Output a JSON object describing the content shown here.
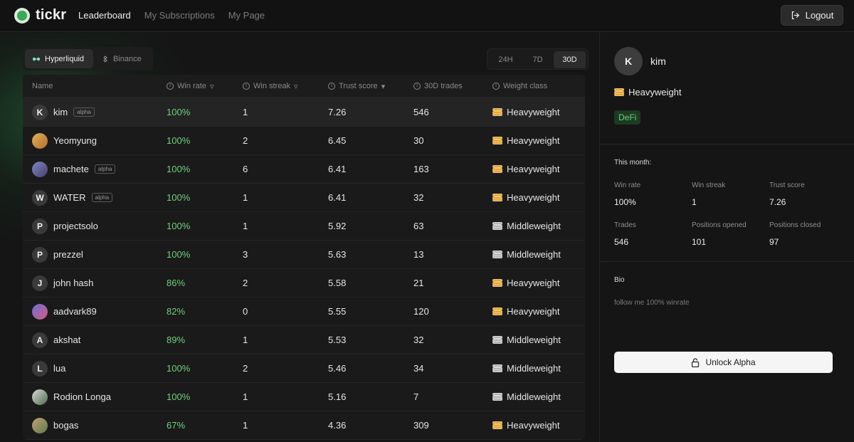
{
  "app": {
    "name": "tickr"
  },
  "nav": {
    "items": [
      {
        "label": "Leaderboard",
        "active": true
      },
      {
        "label": "My Subscriptions",
        "active": false
      },
      {
        "label": "My Page",
        "active": false
      }
    ],
    "logout_label": "Logout"
  },
  "exchanges": [
    {
      "label": "Hyperliquid",
      "icon": "hyperliquid-icon",
      "active": true
    },
    {
      "label": "Binance",
      "icon": "binance-icon",
      "active": false
    }
  ],
  "periods": [
    {
      "label": "24H",
      "active": false
    },
    {
      "label": "7D",
      "active": false
    },
    {
      "label": "30D",
      "active": true
    }
  ],
  "table": {
    "headers": {
      "name": "Name",
      "win_rate": "Win rate",
      "win_streak": "Win streak",
      "trust_score": "Trust score",
      "trades": "30D trades",
      "weight_class": "Weight class"
    },
    "rows": [
      {
        "initial": "K",
        "avatar_style": "",
        "name": "kim",
        "alpha": true,
        "alpha_label": "alpha",
        "win_rate": "100%",
        "streak": "1",
        "trust": "7.26",
        "trades": "546",
        "weight": "Heavyweight",
        "coin": "gold",
        "selected": true
      },
      {
        "initial": "",
        "avatar_style": "img1",
        "name": "Yeomyung",
        "alpha": false,
        "alpha_label": "",
        "win_rate": "100%",
        "streak": "2",
        "trust": "6.45",
        "trades": "30",
        "weight": "Heavyweight",
        "coin": "gold",
        "selected": false
      },
      {
        "initial": "",
        "avatar_style": "img2",
        "name": "machete",
        "alpha": true,
        "alpha_label": "alpha",
        "win_rate": "100%",
        "streak": "6",
        "trust": "6.41",
        "trades": "163",
        "weight": "Heavyweight",
        "coin": "gold",
        "selected": false
      },
      {
        "initial": "W",
        "avatar_style": "",
        "name": "WATER",
        "alpha": true,
        "alpha_label": "alpha",
        "win_rate": "100%",
        "streak": "1",
        "trust": "6.41",
        "trades": "32",
        "weight": "Heavyweight",
        "coin": "gold",
        "selected": false
      },
      {
        "initial": "P",
        "avatar_style": "",
        "name": "projectsolo",
        "alpha": false,
        "alpha_label": "",
        "win_rate": "100%",
        "streak": "1",
        "trust": "5.92",
        "trades": "63",
        "weight": "Middleweight",
        "coin": "silver",
        "selected": false
      },
      {
        "initial": "P",
        "avatar_style": "",
        "name": "prezzel",
        "alpha": false,
        "alpha_label": "",
        "win_rate": "100%",
        "streak": "3",
        "trust": "5.63",
        "trades": "13",
        "weight": "Middleweight",
        "coin": "silver",
        "selected": false
      },
      {
        "initial": "J",
        "avatar_style": "",
        "name": "john hash",
        "alpha": false,
        "alpha_label": "",
        "win_rate": "86%",
        "streak": "2",
        "trust": "5.58",
        "trades": "21",
        "weight": "Heavyweight",
        "coin": "gold",
        "selected": false
      },
      {
        "initial": "",
        "avatar_style": "img3",
        "name": "aadvark89",
        "alpha": false,
        "alpha_label": "",
        "win_rate": "82%",
        "streak": "0",
        "trust": "5.55",
        "trades": "120",
        "weight": "Heavyweight",
        "coin": "gold",
        "selected": false
      },
      {
        "initial": "A",
        "avatar_style": "",
        "name": "akshat",
        "alpha": false,
        "alpha_label": "",
        "win_rate": "89%",
        "streak": "1",
        "trust": "5.53",
        "trades": "32",
        "weight": "Middleweight",
        "coin": "silver",
        "selected": false
      },
      {
        "initial": "L",
        "avatar_style": "",
        "name": "lua",
        "alpha": false,
        "alpha_label": "",
        "win_rate": "100%",
        "streak": "2",
        "trust": "5.46",
        "trades": "34",
        "weight": "Middleweight",
        "coin": "silver",
        "selected": false
      },
      {
        "initial": "",
        "avatar_style": "img4",
        "name": "Rodion Longa",
        "alpha": false,
        "alpha_label": "",
        "win_rate": "100%",
        "streak": "1",
        "trust": "5.16",
        "trades": "7",
        "weight": "Middleweight",
        "coin": "silver",
        "selected": false
      },
      {
        "initial": "",
        "avatar_style": "img5",
        "name": "bogas",
        "alpha": false,
        "alpha_label": "",
        "win_rate": "67%",
        "streak": "1",
        "trust": "4.36",
        "trades": "309",
        "weight": "Heavyweight",
        "coin": "gold",
        "selected": false
      }
    ]
  },
  "profile": {
    "initial": "K",
    "name": "kim",
    "weight": "Heavyweight",
    "tag": "DeFi",
    "stats_title": "This month:",
    "stats": [
      {
        "label": "Win rate",
        "value": "100%",
        "green": true
      },
      {
        "label": "Win streak",
        "value": "1",
        "green": false
      },
      {
        "label": "Trust score",
        "value": "7.26",
        "green": false
      },
      {
        "label": "Trades",
        "value": "546",
        "green": false
      },
      {
        "label": "Positions opened",
        "value": "101",
        "green": false
      },
      {
        "label": "Positions closed",
        "value": "97",
        "green": false
      }
    ],
    "bio_title": "Bio",
    "bio_text": "follow me 100% winrate",
    "unlock_label": "Unlock Alpha"
  },
  "colors": {
    "accent_green": "#6fd17b",
    "gold_coin": "#e2a640",
    "silver_coin": "#b5b5b5"
  }
}
